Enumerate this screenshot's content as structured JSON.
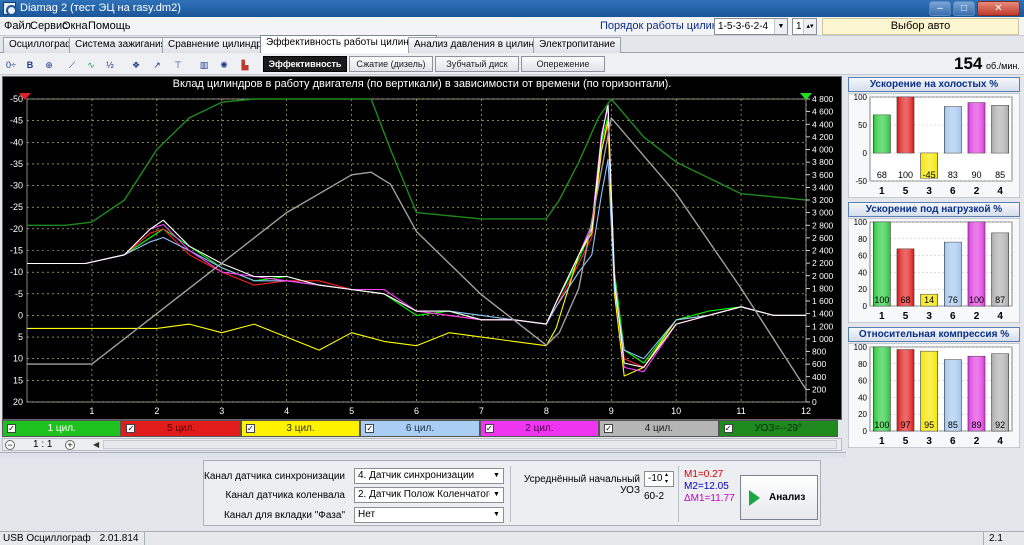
{
  "window": {
    "title": "Diamag 2 (тест ЭЦ на rasy.dm2)"
  },
  "menu": [
    "Файл",
    "Сервис",
    "Окна",
    "Помощь"
  ],
  "cylinder_order": {
    "label": "Порядок работы цилиндров",
    "value": "1-5-3-6-2-4",
    "spin_value": "1"
  },
  "auto_select": "Выбор авто",
  "tabs": [
    {
      "label": "Осциллограф",
      "active": false
    },
    {
      "label": "Система зажигания",
      "active": false
    },
    {
      "label": "Сравнение цилиндров",
      "active": false
    },
    {
      "label": "Эффективность работы цилиндров",
      "active": true
    },
    {
      "label": "Анализ давления в цилиндре",
      "active": false
    },
    {
      "label": "Электропитание",
      "active": false
    }
  ],
  "toolbar": {
    "subtabs": [
      {
        "label": "Эффективность",
        "active": true
      },
      {
        "label": "Сжатие (дизель)",
        "active": false
      },
      {
        "label": "Зубчатый диск",
        "active": false
      },
      {
        "label": "Опережение",
        "active": false
      }
    ],
    "rpm_value": "154",
    "rpm_unit": "об./мин."
  },
  "chart_data": [
    {
      "type": "line",
      "title": "Вклад цилиндров в работу двигателя (по вертикали) в зависимости от времени (по горизонтали).",
      "x_ticks": [
        "1",
        "2",
        "3",
        "4",
        "5",
        "6",
        "7",
        "8",
        "9",
        "10",
        "11",
        "12"
      ],
      "xlim": [
        0,
        12
      ],
      "y_left_ticks": [
        "-50",
        "-45",
        "-40",
        "-35",
        "-30",
        "-25",
        "-20",
        "-15",
        "-10",
        "-5",
        "0",
        "5",
        "10",
        "15",
        "20"
      ],
      "ylim_left": [
        -50,
        20
      ],
      "y_right_ticks": [
        "4 800",
        "4 600",
        "4 400",
        "4 200",
        "4 000",
        "3 800",
        "3 600",
        "3 400",
        "3 200",
        "3 000",
        "2 800",
        "2 600",
        "2 400",
        "2 200",
        "2 000",
        "1 800",
        "1 600",
        "1 400",
        "1 200",
        "1 000",
        "800",
        "600",
        "400",
        "200",
        "0"
      ],
      "ylim_right": [
        0,
        4800
      ],
      "grid": true,
      "series": [
        {
          "color": "#00ff00",
          "x": [
            0.0,
            0.9,
            1.5,
            1.9,
            2.1,
            2.5,
            3,
            3.5,
            4,
            4.5,
            5,
            5.5,
            6,
            6.5,
            7,
            7.5,
            8.0,
            8.15,
            8.5,
            8.7,
            8.85,
            8.95,
            9.05,
            9.2,
            9.5,
            10,
            10.5,
            11,
            11.5,
            12
          ],
          "y": [
            -12,
            -12,
            -14,
            -18,
            -20,
            -16,
            -11,
            -8,
            -9,
            -7,
            -6,
            -5,
            0,
            -1,
            1,
            1,
            2,
            -3,
            -13,
            -20,
            -40,
            -46,
            -10,
            8,
            11,
            1,
            -1,
            -2,
            0,
            0
          ]
        },
        {
          "color": "#ff2020",
          "x": [
            0.0,
            0.9,
            1.5,
            1.9,
            2.1,
            2.5,
            3,
            3.5,
            4,
            4.5,
            5,
            5.5,
            6,
            6.5,
            7,
            7.5,
            8.0,
            8.15,
            8.5,
            8.7,
            8.85,
            8.95,
            9.05,
            9.2,
            9.5,
            10,
            10.5,
            11,
            11.5,
            12
          ],
          "y": [
            -12,
            -12,
            -14,
            -19,
            -20,
            -14,
            -10,
            -7,
            -8,
            -8,
            -6,
            -5,
            -1,
            0,
            1,
            1,
            2,
            -2,
            -12,
            -18,
            -38,
            -44,
            -8,
            10,
            12,
            2,
            0,
            -2,
            0,
            0
          ]
        },
        {
          "color": "#ffff00",
          "x": [
            0.0,
            0.9,
            1.5,
            2,
            2.5,
            3,
            3.5,
            4,
            4.5,
            5,
            5.5,
            6,
            6.5,
            7,
            7.5,
            8.0,
            8.15,
            8.5,
            8.7,
            8.85,
            8.95,
            9.05,
            9.2,
            9.5,
            10,
            10.5,
            11,
            11.5,
            12
          ],
          "y": [
            3,
            3,
            3,
            3,
            2,
            4,
            2,
            5,
            8,
            4,
            6,
            7,
            4,
            5,
            6,
            7,
            3,
            -14,
            -19,
            -38,
            -45,
            -5,
            14,
            12,
            1,
            0,
            -2,
            0,
            0
          ]
        },
        {
          "color": "#8fc6ff",
          "x": [
            0.0,
            0.9,
            1.5,
            1.9,
            2.1,
            2.5,
            3,
            3.5,
            4,
            4.5,
            5,
            5.5,
            6,
            6.5,
            7,
            7.5,
            8.0,
            8.15,
            8.5,
            8.7,
            8.85,
            8.95,
            9.05,
            9.2,
            9.5,
            10,
            10.5,
            11,
            11.5,
            12
          ],
          "y": [
            -12,
            -12,
            -14,
            -17,
            -18,
            -15,
            -11,
            -8,
            -8,
            -7,
            -6,
            -5,
            -1,
            -1,
            0,
            1,
            2,
            -2,
            -10,
            -14,
            -28,
            -36,
            -6,
            8,
            10,
            1,
            0,
            -2,
            0,
            0
          ]
        },
        {
          "color": "#ff40ff",
          "x": [
            0.0,
            0.9,
            1.5,
            1.9,
            2.1,
            2.5,
            3,
            3.5,
            4,
            4.5,
            5,
            5.5,
            6,
            6.5,
            7,
            7.5,
            8.0,
            8.15,
            8.5,
            8.7,
            8.85,
            8.95,
            9.05,
            9.2,
            9.5,
            10,
            10.5,
            11,
            11.5,
            12
          ],
          "y": [
            -12,
            -12,
            -14,
            -20,
            -21,
            -15,
            -10,
            -9,
            -8,
            -7,
            -6,
            -6,
            -1,
            0,
            1,
            1,
            2,
            -3,
            -14,
            -21,
            -42,
            -48,
            -9,
            12,
            13,
            2,
            0,
            -2,
            0,
            0
          ]
        },
        {
          "color": "#ffffff",
          "x": [
            0.0,
            0.9,
            1.5,
            1.9,
            2.1,
            2.5,
            3,
            3.5,
            4,
            4.5,
            5,
            5.5,
            6,
            6.5,
            7,
            7.5,
            8.0,
            8.15,
            8.5,
            8.7,
            8.85,
            8.95,
            9.05,
            9.2,
            9.5,
            10,
            10.5,
            11,
            11.5,
            12
          ],
          "y": [
            -12,
            -12,
            -14,
            -20,
            -22,
            -16,
            -12,
            -9,
            -9,
            -7,
            -6,
            -5,
            -1,
            -1,
            1,
            1,
            2,
            -3,
            -14,
            -20,
            -41,
            -49,
            -8,
            11,
            12,
            2,
            0,
            -2,
            0,
            0
          ]
        },
        {
          "color": "#a0a0a0",
          "x": [
            0.0,
            1,
            2,
            3,
            4,
            5,
            5.3,
            5.6,
            6,
            7,
            8,
            8.2,
            8.5,
            8.8,
            9.0,
            9.5,
            10,
            11,
            12
          ],
          "y_right": [
            600,
            600,
            1400,
            2200,
            3000,
            3600,
            3640,
            3450,
            2700,
            1700,
            900,
            1100,
            1800,
            3400,
            4500,
            3900,
            3300,
            1800,
            200
          ]
        },
        {
          "color": "#1e8a1e",
          "x": [
            0.0,
            0.6,
            1.0,
            1.5,
            2,
            2.5,
            3,
            3.5,
            4,
            5,
            5.3,
            5.6,
            6,
            7,
            8,
            8.2,
            8.5,
            8.8,
            9.0,
            9.5,
            10,
            11,
            12
          ],
          "y_right": [
            2800,
            2800,
            2850,
            3200,
            4000,
            4500,
            4750,
            4800,
            4800,
            4800,
            4800,
            4000,
            3000,
            2900,
            2900,
            3200,
            3800,
            4500,
            4800,
            4200,
            3800,
            3300,
            3200
          ]
        }
      ]
    },
    {
      "type": "bar",
      "title": "Ускорение на холостых %",
      "categories": [
        "1",
        "5",
        "3",
        "6",
        "2",
        "4"
      ],
      "values": [
        68,
        100,
        -45,
        83,
        90,
        85
      ],
      "y_ticks": [
        "100",
        "50",
        "0",
        "-50"
      ],
      "ylim": [
        -50,
        100
      ],
      "colors": [
        "#2ecc40",
        "#e02020",
        "#f5e800",
        "#a6c8f0",
        "#e040e0",
        "#b0b0b0"
      ]
    },
    {
      "type": "bar",
      "title": "Ускорение под нагрузкой %",
      "categories": [
        "1",
        "5",
        "3",
        "6",
        "2",
        "4"
      ],
      "values": [
        100,
        68,
        14,
        76,
        100,
        87
      ],
      "y_ticks": [
        "100",
        "80",
        "60",
        "40",
        "20",
        "0"
      ],
      "ylim": [
        0,
        100
      ],
      "colors": [
        "#2ecc40",
        "#e02020",
        "#f5e800",
        "#a6c8f0",
        "#e040e0",
        "#b0b0b0"
      ]
    },
    {
      "type": "bar",
      "title": "Относительная компрессия %",
      "categories": [
        "1",
        "5",
        "3",
        "6",
        "2",
        "4"
      ],
      "values": [
        100,
        97,
        95,
        85,
        89,
        92
      ],
      "y_ticks": [
        "100",
        "80",
        "60",
        "40",
        "20",
        "0"
      ],
      "ylim": [
        0,
        100
      ],
      "colors": [
        "#2ecc40",
        "#e02020",
        "#f5e800",
        "#a6c8f0",
        "#e040e0",
        "#b0b0b0"
      ]
    }
  ],
  "channels": [
    {
      "label": "1 цил.",
      "bg": "#1ec21e",
      "fg": "#ffffff",
      "checked": true
    },
    {
      "label": "5 цил.",
      "bg": "#e21b1b",
      "fg": "#5a0000",
      "checked": true
    },
    {
      "label": "3 цил.",
      "bg": "#fff200",
      "fg": "#333300",
      "checked": true
    },
    {
      "label": "6 цил.",
      "bg": "#a9cdf3",
      "fg": "#1a2f4a",
      "checked": true
    },
    {
      "label": "2 цил.",
      "bg": "#ef35ef",
      "fg": "#4a004a",
      "checked": true
    },
    {
      "label": "4 цил.",
      "bg": "#b5b5b5",
      "fg": "#1a1a1a",
      "checked": true
    },
    {
      "label": "УОЗ=--29°",
      "bg": "#1e8a1e",
      "fg": "#0a2a0a",
      "checked": true
    }
  ],
  "zoom": "1 : 1",
  "settings": {
    "sync_channel_label": "Канал датчика синхронизации",
    "sync_channel_value": "4. Датчик синхронизации",
    "crank_channel_label": "Канал датчика коленвала",
    "crank_channel_value": "2. Датчик Полож Коленчатого Вал",
    "phase_channel_label": "Канал для вкладки \"Фаза\"",
    "phase_channel_value": "Нет",
    "avg_uoz_label": "Усреднённый начальный УОЗ",
    "avg_uoz_value": "-10",
    "disk_type": "60-2",
    "m1": "M1=0.27",
    "m2": "M2=12.05",
    "dm1": "ΔM1=11.77",
    "analyze_label": "Анализ"
  },
  "statusbar": {
    "device": "USB Осциллограф",
    "version": "2.01.814",
    "right": "2.1"
  }
}
